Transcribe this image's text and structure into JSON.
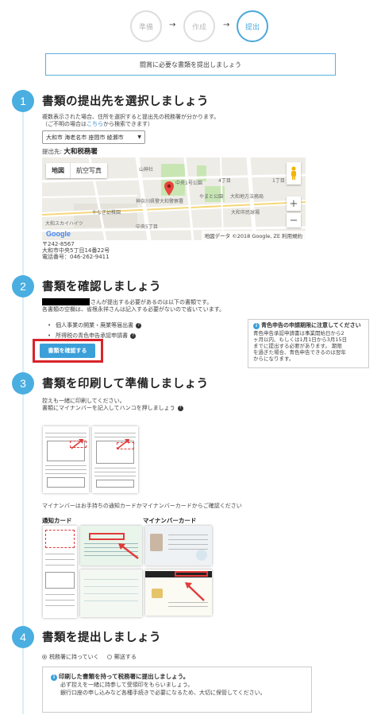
{
  "stepper": {
    "steps": [
      "準備",
      "作成",
      "提出"
    ],
    "arrow": "→",
    "active": 2
  },
  "banner": "闘賞に必要な書類を提出しましょう",
  "sections": [
    {
      "num": "1",
      "title": "書類の提出先を選択しましょう"
    },
    {
      "num": "2",
      "title": "書類を確認しましょう"
    },
    {
      "num": "3",
      "title": "書類を印刷して準備しましょう"
    },
    {
      "num": "4",
      "title": "書類を提出しましょう"
    }
  ],
  "section1": {
    "desc1": "複数表示された場合、住所を選択すると提出先の税務署が分かります。",
    "desc2_pre": "（ご不明の場合は",
    "desc2_link": "こちら",
    "desc2_post": "から検索できます）",
    "select_value": "大和市 海老名市 座間市 綾瀬市",
    "select_arrow": "▼",
    "office_label": "提出先:",
    "office_name": "大和税務署",
    "map": {
      "tab_map": "地図",
      "tab_sat": "航空写真",
      "labels": [
        "山神社",
        "中央1号公園",
        "やまと公園",
        "神奈川県警大和警察署",
        "大和地方法務局",
        "大和市民球場",
        "大和スカイハイツ",
        "やなぎ幼稚園",
        "中央5丁目",
        "1丁目",
        "4丁目"
      ],
      "zoom_in": "+",
      "zoom_out": "−",
      "copyright": "地図データ ©2018 Google, ZE 利用規約",
      "google": "Google"
    },
    "address_zip": "〒242-8567",
    "address_line": "大和市中央5丁目14番22号",
    "address_tel": "電話番号：046-262-9411"
  },
  "section2": {
    "desc1": "さんが提出する必要があるのは以下の書類です。",
    "desc2": "各書類の空欄は、省根永祥さんは記入する必要がないので省いています。",
    "items": [
      "個人事業の開業・廃業等届出書",
      "所得税の青色申告承認申請書"
    ],
    "help_icon": "?",
    "confirm_button": "書類を確認する",
    "notice_title": "青色申告の申請期限に注意してください",
    "notice_body": [
      "青色申告承認申請書は事業開始日から2",
      "ヶ月以内、もしくは1月1日から3月15日",
      "までに提出する必要があります。 期限",
      "を過ぎた場合、青色申告できるのは翌年",
      "からになります。"
    ]
  },
  "section3": {
    "desc1": "控えも一緒に印刷してください。",
    "desc2": "書類にマイナンバーを記入してハンコを押しましょう",
    "card_note": "マイナンバーはお手持ちの通知カードかマイナンバーカードからご確認ください",
    "notify_card": "通知カード",
    "mynumber_card": "マイナンバーカード"
  },
  "section4": {
    "option1": "税務署に持っていく",
    "option2": "郵送する",
    "info_title": "印刷した書類を持って税務署に提出しましょう。",
    "info_line1": "必ず控えを一緒に持参して受領印をもらいましょう。",
    "info_line2": "銀行口座の申し込みなど各種手続きで必要になるため、大切に保管してください。"
  }
}
